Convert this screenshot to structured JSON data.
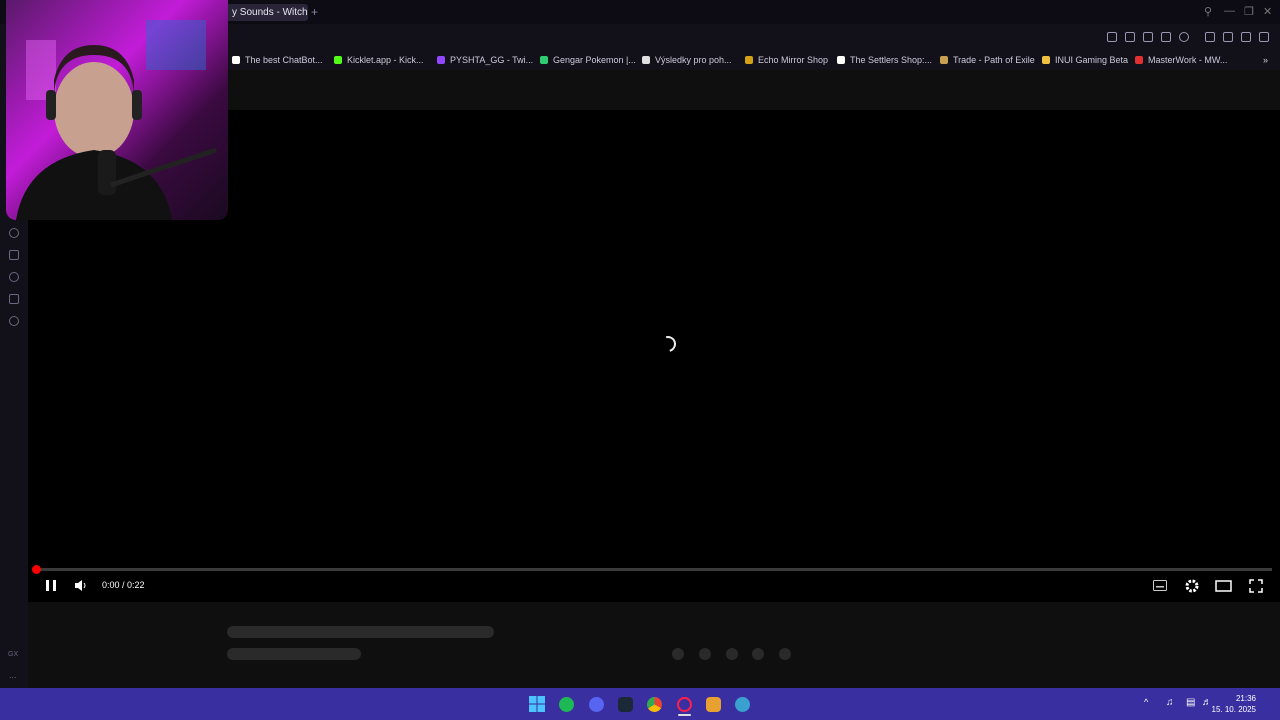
{
  "browser": {
    "active_tab_title": "y Sounds - Witch's",
    "new_tab_symbol": "+"
  },
  "bookmarks": [
    {
      "label": "The best ChatBot...",
      "color": "#ffffff"
    },
    {
      "label": "Kicklet.app - Kick...",
      "color": "#53fc18"
    },
    {
      "label": "PYSHTA_GG - Twi...",
      "color": "#9146ff"
    },
    {
      "label": "Gengar Pokemon |...",
      "color": "#2ecc71"
    },
    {
      "label": "Výsledky pro poh...",
      "color": "#e0e0e0"
    },
    {
      "label": "Echo Mirror Shop",
      "color": "#d4a017"
    },
    {
      "label": "The Settlers Shop:...",
      "color": "#ffffff"
    },
    {
      "label": "Trade - Path of Exile",
      "color": "#c8a050"
    },
    {
      "label": "INUI Gaming Beta",
      "color": "#f0c040"
    },
    {
      "label": "MasterWork - MW...",
      "color": "#e03030"
    }
  ],
  "player": {
    "time_display": "0:00 / 0:22",
    "progress_fraction": 0.0
  },
  "sidebar": {
    "bottom_label": "GX",
    "more_label": "..."
  },
  "taskbar": {
    "time": "21:36",
    "date": "15. 10. 2025",
    "accent": "#3a2fa0"
  }
}
